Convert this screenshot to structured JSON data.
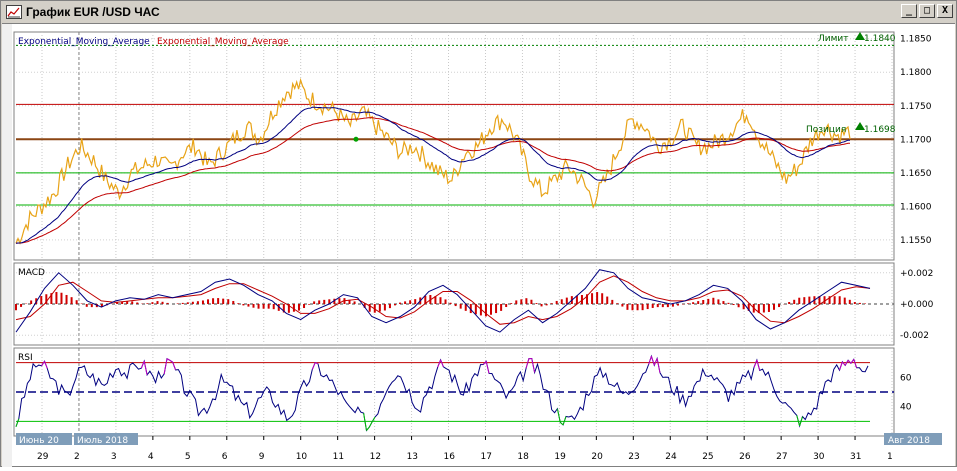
{
  "window": {
    "title": "График EUR /USD  ЧАС",
    "buttons": {
      "minimize": "_",
      "restore": "□",
      "close": "X"
    }
  },
  "colors": {
    "price": "#e8a317",
    "ema_fast": "#000080",
    "ema_slow": "#c00000",
    "hline_red": "#c00000",
    "hline_brown": "#8b4513",
    "hline_green": "#00b000",
    "limit_line": "#008000",
    "macd_hist": "#d00000",
    "rsi_line": "#000080",
    "rsi_overbought": "#c000c0",
    "rsi_oversold": "#00c000"
  },
  "chart_data": [
    {
      "type": "line",
      "panel": "price",
      "legend": [
        "Exponential_Moving_Average",
        "Exponential_Moving_Average"
      ],
      "y_ticks": [
        "1.1850",
        "1.1800",
        "1.1750",
        "1.1700",
        "1.1650",
        "1.1600",
        "1.1550"
      ],
      "ylim": [
        1.152,
        1.186
      ],
      "hlines": [
        {
          "y": 1.1752,
          "color": "red"
        },
        {
          "y": 1.17,
          "color": "brown"
        },
        {
          "y": 1.165,
          "color": "green"
        },
        {
          "y": 1.1602,
          "color": "green"
        }
      ],
      "annotations": {
        "limit_label": "Лимит",
        "limit_value": "1.1840",
        "position_label": "Позиция",
        "position_value": "1.1698"
      },
      "x_days": [
        "29",
        "2",
        "3",
        "4",
        "5",
        "6",
        "9",
        "10",
        "11",
        "12",
        "13",
        "16",
        "17",
        "18",
        "19",
        "20",
        "23",
        "24",
        "25",
        "26",
        "27",
        "30",
        "31",
        "1"
      ],
      "price_series": [
        1.1545,
        1.158,
        1.16,
        1.162,
        1.166,
        1.169,
        1.167,
        1.164,
        1.162,
        1.165,
        1.166,
        1.167,
        1.1655,
        1.168,
        1.169,
        1.166,
        1.168,
        1.17,
        1.172,
        1.17,
        1.174,
        1.177,
        1.178,
        1.176,
        1.175,
        1.174,
        1.172,
        1.174,
        1.172,
        1.17,
        1.168,
        1.169,
        1.167,
        1.165,
        1.164,
        1.168,
        1.169,
        1.172,
        1.173,
        1.17,
        1.165,
        1.162,
        1.164,
        1.166,
        1.164,
        1.161,
        1.164,
        1.169,
        1.173,
        1.172,
        1.169,
        1.17,
        1.172,
        1.169,
        1.169,
        1.17,
        1.172,
        1.174,
        1.17,
        1.167,
        1.164,
        1.166,
        1.17,
        1.172,
        1.1705,
        1.1712
      ]
    },
    {
      "type": "bar",
      "panel": "macd",
      "title": "MACD",
      "y_ticks": [
        "+0.002",
        "+0.000",
        "-0.002"
      ],
      "ylim": [
        -0.0025,
        0.0025
      ],
      "macd_series": [
        -0.0018,
        -0.0005,
        0.001,
        0.002,
        0.0012,
        0.0002,
        -0.0002,
        0.0002,
        0.0004,
        0.0003,
        0.0006,
        0.0004,
        0.0006,
        0.0008,
        0.0014,
        0.0016,
        0.0012,
        0.0006,
        0.0002,
        -0.0006,
        -0.001,
        -0.0004,
        0.0,
        0.0006,
        0.0004,
        -0.0008,
        -0.0012,
        -0.0008,
        -0.0002,
        0.0008,
        0.0012,
        0.0006,
        -0.0004,
        -0.0014,
        -0.0018,
        -0.001,
        -0.0004,
        -0.0012,
        -0.0006,
        0.0002,
        0.001,
        0.0022,
        0.002,
        0.001,
        0.0004,
        0.0002,
        0.0,
        0.0002,
        0.0006,
        0.0012,
        0.001,
        0.0002,
        -0.001,
        -0.0016,
        -0.0012,
        -0.0004,
        0.0002,
        0.0008,
        0.0014,
        0.0012,
        0.001
      ],
      "signal_series": [
        -0.001,
        -0.0008,
        0.0,
        0.0012,
        0.0014,
        0.0008,
        0.0002,
        0.0001,
        0.0002,
        0.0003,
        0.0004,
        0.0004,
        0.0005,
        0.0006,
        0.001,
        0.0013,
        0.0013,
        0.0009,
        0.0005,
        0.0,
        -0.0006,
        -0.0006,
        -0.0003,
        0.0002,
        0.0003,
        -0.0002,
        -0.0008,
        -0.0009,
        -0.0005,
        0.0002,
        0.0008,
        0.0008,
        0.0002,
        -0.0006,
        -0.0013,
        -0.0012,
        -0.0008,
        -0.001,
        -0.0008,
        -0.0003,
        0.0004,
        0.0014,
        0.0018,
        0.0014,
        0.0008,
        0.0004,
        0.0002,
        0.0002,
        0.0004,
        0.0008,
        0.0009,
        0.0005,
        -0.0004,
        -0.0011,
        -0.0012,
        -0.0008,
        -0.0003,
        0.0003,
        0.0009,
        0.0011,
        0.001
      ],
      "histogram": [
        -0.0004,
        0.0002,
        0.0006,
        0.0008,
        0.0004,
        -0.0002,
        -0.0002,
        0.0001,
        0.0002,
        0.0,
        0.0002,
        0.0,
        0.0001,
        0.0002,
        0.0004,
        0.0003,
        -0.0001,
        -0.0003,
        -0.0003,
        -0.0006,
        -0.0004,
        0.0002,
        0.0003,
        0.0004,
        0.0001,
        -0.0006,
        -0.0004,
        0.0001,
        0.0003,
        0.0006,
        0.0004,
        -0.0002,
        -0.0006,
        -0.0008,
        -0.0005,
        0.0002,
        0.0004,
        -0.0002,
        0.0002,
        0.0005,
        0.0006,
        0.0008,
        0.0002,
        -0.0004,
        -0.0004,
        -0.0002,
        -0.0002,
        0.0,
        0.0002,
        0.0004,
        0.0001,
        -0.0003,
        -0.0006,
        -0.0005,
        0.0,
        0.0004,
        0.0005,
        0.0005,
        0.0005,
        0.0001,
        0.0
      ]
    },
    {
      "type": "line",
      "panel": "rsi",
      "title": "RSI",
      "y_ticks": [
        "60",
        "40"
      ],
      "ylim": [
        20,
        80
      ],
      "levels": {
        "upper": 70,
        "middle": 50,
        "lower": 30
      },
      "rsi_series": [
        28,
        45,
        62,
        70,
        66,
        58,
        52,
        46,
        60,
        66,
        62,
        58,
        54,
        64,
        68,
        62,
        66,
        70,
        64,
        58,
        66,
        70,
        62,
        52,
        44,
        36,
        40,
        48,
        58,
        54,
        46,
        40,
        36,
        44,
        50,
        46,
        38,
        32,
        40,
        52,
        60,
        68,
        62,
        56,
        50,
        40,
        36,
        34,
        26,
        36,
        48,
        60,
        64,
        56,
        46,
        40,
        52,
        60,
        70,
        64,
        56,
        48,
        58,
        66,
        68,
        60,
        52,
        46,
        54,
        62,
        70,
        64,
        52,
        42,
        34,
        30,
        32,
        40,
        52,
        60,
        64,
        58,
        52,
        48,
        54,
        62,
        68,
        72,
        62,
        56,
        50,
        44,
        52,
        58,
        66,
        60,
        54,
        48,
        52,
        58,
        62,
        68,
        64,
        56,
        48,
        40,
        34,
        30,
        34,
        42,
        54,
        62,
        66,
        70,
        74,
        66,
        64
      ]
    }
  ],
  "x_axis": {
    "labels": [
      "29",
      "2",
      "3",
      "4",
      "5",
      "6",
      "9",
      "10",
      "11",
      "12",
      "13",
      "16",
      "17",
      "18",
      "19",
      "20",
      "23",
      "24",
      "25",
      "26",
      "27",
      "30",
      "31",
      "1"
    ],
    "period_labels": {
      "june": "Июнь 20",
      "july": "Июль 2018",
      "aug": "Авг 2018"
    }
  }
}
